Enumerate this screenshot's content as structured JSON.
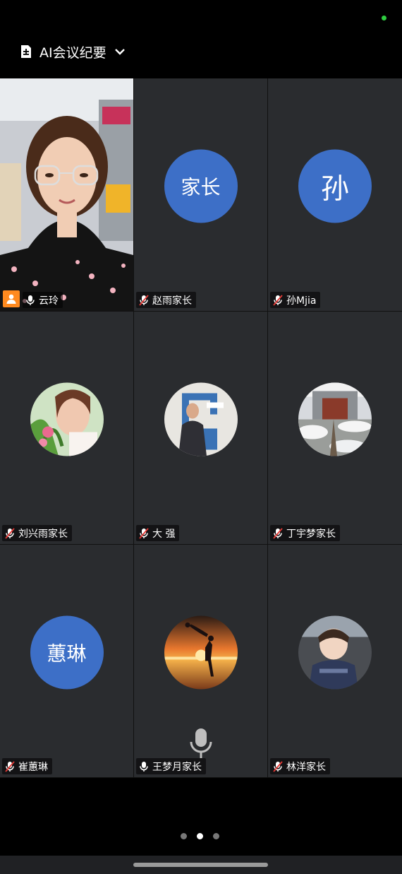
{
  "header": {
    "title": "AI会议纪要"
  },
  "participants": [
    {
      "name": "云玲",
      "muted": false,
      "host": true,
      "type": "video"
    },
    {
      "name": "赵雨家长",
      "muted": true,
      "avatar_text": "家长",
      "type": "text"
    },
    {
      "name": "孙Mjia",
      "muted": true,
      "avatar_text": "孙",
      "type": "text"
    },
    {
      "name": "刘兴雨家长",
      "muted": true,
      "type": "photo"
    },
    {
      "name": "大 强",
      "muted": true,
      "type": "photo"
    },
    {
      "name": "丁宇梦家长",
      "muted": true,
      "type": "photo"
    },
    {
      "name": "崔蕙琳",
      "muted": true,
      "avatar_text": "蕙琳",
      "type": "text"
    },
    {
      "name": "王梦月家长",
      "muted": false,
      "type": "photo"
    },
    {
      "name": "林洋家长",
      "muted": true,
      "type": "photo"
    }
  ],
  "pager": {
    "pages": 3,
    "current": 2
  },
  "colors": {
    "avatar_blue": "#3d6fc7",
    "host_orange": "#ff8a1f",
    "tile_bg": "#2a2c2f"
  }
}
